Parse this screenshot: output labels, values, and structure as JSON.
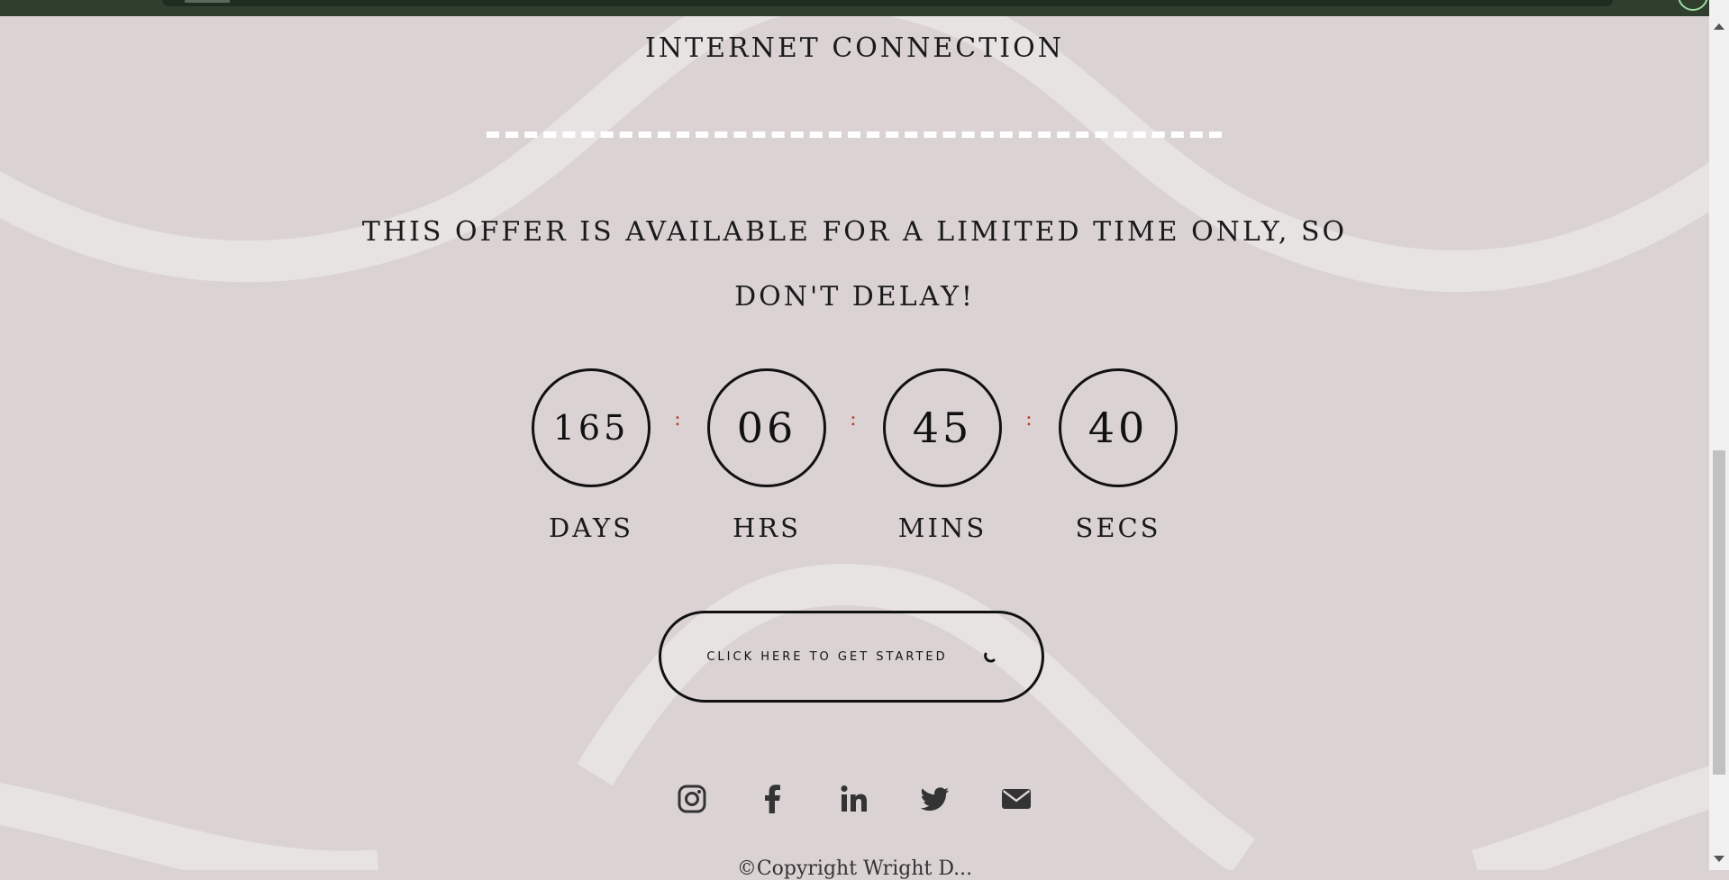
{
  "header": {
    "partial_heading": "INTERNET CONNECTION"
  },
  "offer": {
    "line1": "THIS OFFER IS AVAILABLE FOR A LIMITED TIME ONLY, SO",
    "line2": "DON'T DELAY!"
  },
  "countdown": {
    "days": "165",
    "hours": "06",
    "minutes": "45",
    "seconds": "40",
    "separator": ":",
    "labels": {
      "days": "DAYS",
      "hours": "HRS",
      "minutes": "MINS",
      "seconds": "SECS"
    }
  },
  "cta": {
    "label": "CLICK HERE TO GET STARTED"
  },
  "social": {
    "icons": [
      "instagram-icon",
      "facebook-icon",
      "linkedin-icon",
      "twitter-icon",
      "email-icon"
    ]
  },
  "footer": {
    "copyright": "©Copyright Wright D..."
  },
  "colors": {
    "background": "#dbd3d3",
    "accent": "#c0392b",
    "topbar": "#2f3e2d",
    "text": "#111111"
  }
}
